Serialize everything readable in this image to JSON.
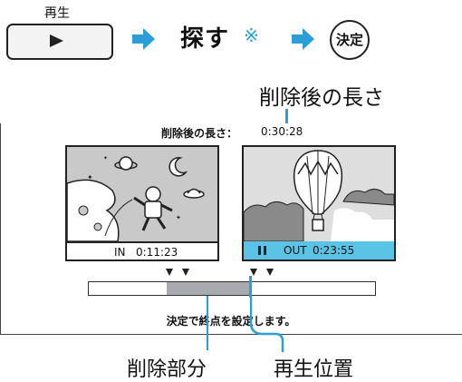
{
  "controls": {
    "play_caption": "再生",
    "play_icon": "play-triangle",
    "search_label": "探す",
    "search_note_mark": "※",
    "confirm_label": "決定",
    "arrow_color": "#2a9fd6"
  },
  "callouts": {
    "length_after_delete": "削除後の長さ",
    "deleted_part": "削除部分",
    "play_position": "再生位置"
  },
  "panel": {
    "length_label": "削除後の長さ：",
    "length_value": "0:30:28",
    "in_frame": {
      "tag": "IN",
      "time": "0:11:23"
    },
    "out_frame": {
      "pause_icon": "pause-icon",
      "tag": "OUT",
      "time": "0:23:55"
    },
    "status_message": "決定で終点を設定します。"
  },
  "colors": {
    "accent": "#2a9fd6",
    "out_caption_bg": "#5bc4e6",
    "deleted_segment": "#a9a9b0"
  }
}
